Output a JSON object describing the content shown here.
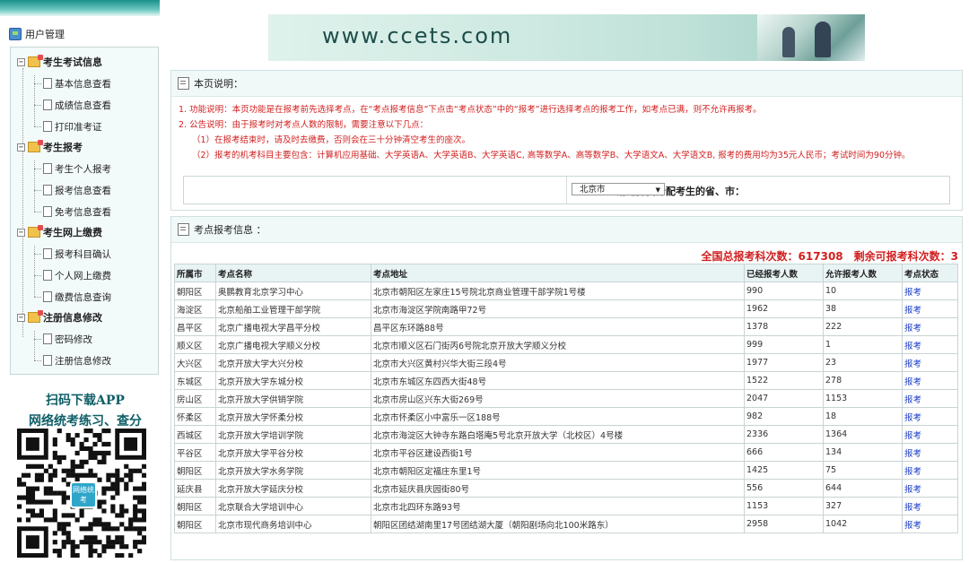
{
  "banner": {
    "url": "www.ccets.com"
  },
  "sidebar": {
    "title": "用户管理",
    "groups": [
      {
        "label": "考生考试信息",
        "items": [
          "基本信息查看",
          "成绩信息查看",
          "打印准考证"
        ]
      },
      {
        "label": "考生报考",
        "items": [
          "考生个人报考",
          "报考信息查看",
          "免考信息查看"
        ]
      },
      {
        "label": "考生网上缴费",
        "items": [
          "报考科目确认",
          "个人网上缴费",
          "缴费信息查询"
        ]
      },
      {
        "label": "注册信息修改",
        "items": [
          "密码修改",
          "注册信息修改"
        ]
      }
    ],
    "promo": {
      "line1": "扫码下载APP",
      "line2": "网络统考练习、查分",
      "logo_text": "网络统考"
    }
  },
  "notice": {
    "title": "本页说明：",
    "lines": [
      "1. 功能说明：本页功能是在报考前先选择考点，在“考点报考信息”下点击“考点状态”中的“报考”进行选择考点的报考工作，如考点已满，则不允许再报考。",
      "2. 公告说明：由于报考时对考点人数的限制，需要注意以下几点：",
      "（1）在报考结束时，请及时去缴费，否则会在三十分钟清空考生的座次。",
      "（2）报考的机考科目主要包含：计算机应用基础、大学英语A、大学英语B、大学英语C, 高等数学A、高等数学B、大学语文A、大学语文B, 报考的费用均为35元人民币；考试时间为90分钟。"
    ]
  },
  "selector": {
    "label": "请选择要分配考生的省、市：",
    "value": "北京市"
  },
  "exam_info": {
    "title": "考点报考信息 ：",
    "stats": "全国总报考科次数：617308　剩余可报考科次数：3",
    "columns": [
      "所属市",
      "考点名称",
      "考点地址",
      "已经报考人数",
      "允许报考人数",
      "考点状态"
    ],
    "rows": [
      [
        "朝阳区",
        "奥鹏教育北京学习中心",
        "北京市朝阳区左家庄15号院北京商业管理干部学院1号楼",
        "990",
        "10",
        "报考"
      ],
      [
        "海淀区",
        "北京船舶工业管理干部学院",
        "北京市海淀区学院南路甲72号",
        "1962",
        "38",
        "报考"
      ],
      [
        "昌平区",
        "北京广播电视大学昌平分校",
        "昌平区东环路88号",
        "1378",
        "222",
        "报考"
      ],
      [
        "顺义区",
        "北京广播电视大学顺义分校",
        "北京市顺义区石门街丙6号院北京开放大学顺义分校",
        "999",
        "1",
        "报考"
      ],
      [
        "大兴区",
        "北京开放大学大兴分校",
        "北京市大兴区黄村兴华大街三段4号",
        "1977",
        "23",
        "报考"
      ],
      [
        "东城区",
        "北京开放大学东城分校",
        "北京市东城区东四西大街48号",
        "1522",
        "278",
        "报考"
      ],
      [
        "房山区",
        "北京开放大学供销学院",
        "北京市房山区兴东大街269号",
        "2047",
        "1153",
        "报考"
      ],
      [
        "怀柔区",
        "北京开放大学怀柔分校",
        "北京市怀柔区小中富乐一区188号",
        "982",
        "18",
        "报考"
      ],
      [
        "西城区",
        "北京开放大学培训学院",
        "北京市海淀区大钟寺东路白塔庵5号北京开放大学（北校区）4号楼",
        "2336",
        "1364",
        "报考"
      ],
      [
        "平谷区",
        "北京开放大学平谷分校",
        "北京市平谷区建设西街1号",
        "666",
        "134",
        "报考"
      ],
      [
        "朝阳区",
        "北京开放大学水务学院",
        "北京市朝阳区定福庄东里1号",
        "1425",
        "75",
        "报考"
      ],
      [
        "延庆县",
        "北京开放大学延庆分校",
        "北京市延庆县庆园街80号",
        "556",
        "644",
        "报考"
      ],
      [
        "朝阳区",
        "北京联合大学培训中心",
        "北京市北四环东路93号",
        "1153",
        "327",
        "报考"
      ],
      [
        "朝阳区",
        "北京市现代商务培训中心",
        "朝阳区团结湖南里17号团结湖大厦（朝阳剧场向北100米路东）",
        "2958",
        "1042",
        "报考"
      ]
    ]
  }
}
